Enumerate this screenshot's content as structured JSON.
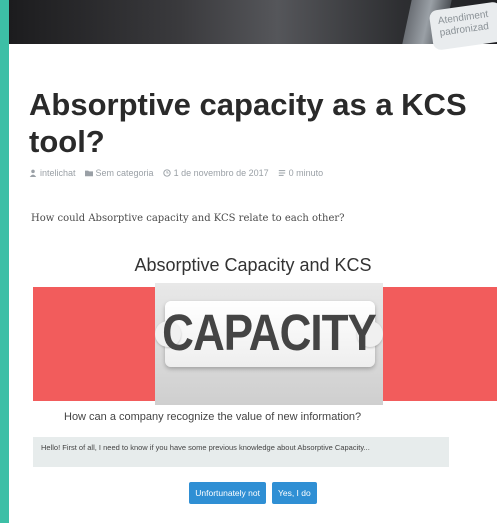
{
  "post": {
    "title": "Absorptive capacity as a KCS tool?",
    "meta": {
      "author": "intelichat",
      "category": "Sem categoria",
      "date": "1 de novembro de 2017",
      "reading_time": "0 minuto"
    },
    "intro": "How could Absorptive capacity and KCS relate to each other?"
  },
  "hero": {
    "sticker_line1": "Atendiment",
    "sticker_line2": "padronizad"
  },
  "chat": {
    "title": "Absorptive Capacity and KCS",
    "banner_word": "CAPACITY",
    "question": "How can a company recognize the value of new information?",
    "bot_message": "Hello! First of all, I need to know if you have some previous knowledge about Absorptive Capacity...",
    "choices": [
      "Unfortunately not",
      "Yes, I do"
    ]
  },
  "colors": {
    "frame": "#3dbfa6",
    "banner_red": "#f25c5c",
    "button_blue": "#2f8fd4"
  }
}
